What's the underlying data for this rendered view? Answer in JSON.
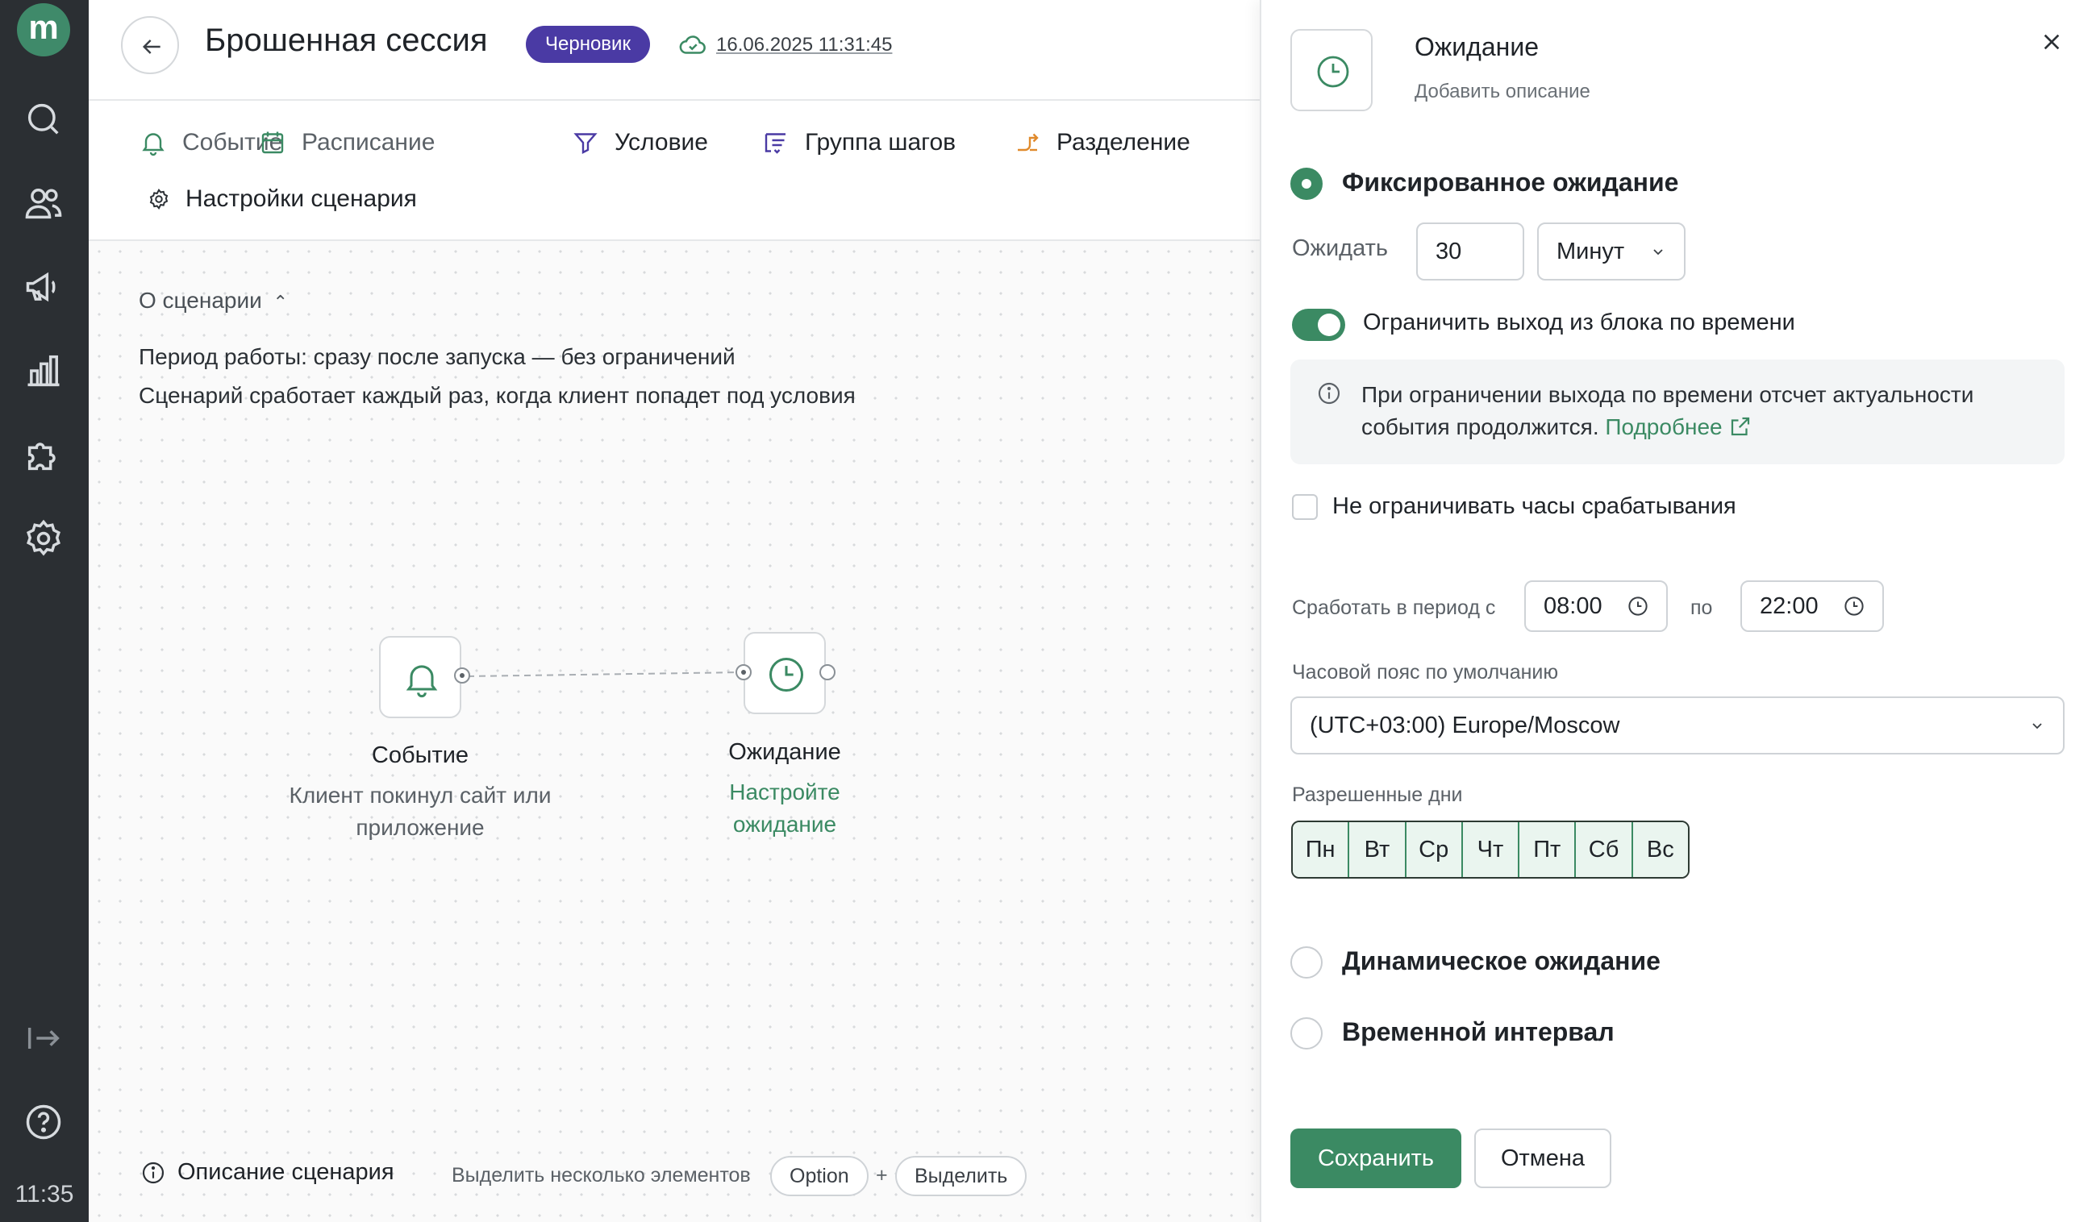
{
  "sidebar": {
    "logo_letter": "m",
    "icons": [
      "search-icon",
      "users-icon",
      "megaphone-icon",
      "analytics-icon",
      "puzzle-icon",
      "settings-icon",
      "logout-icon",
      "help-icon"
    ],
    "time": "11:35"
  },
  "header": {
    "title": "Брошенная сессия",
    "badge": "Черновик",
    "saved_at": "16.06.2025 11:31:45"
  },
  "toolbar": {
    "items": [
      {
        "label": "Событие",
        "icon": "bell-icon"
      },
      {
        "label": "Расписание",
        "icon": "calendar-icon"
      },
      {
        "label": "Условие",
        "icon": "filter-icon"
      },
      {
        "label": "Группа шагов",
        "icon": "step-group-icon"
      },
      {
        "label": "Разделение",
        "icon": "split-icon"
      },
      {
        "label": "Настройки сценария",
        "icon": "gear-icon"
      }
    ]
  },
  "about": {
    "title": "О сценарии",
    "lines": [
      "Период работы: сразу после запуска — без ограничений",
      "Сценарий сработает каждый раз, когда клиент попадет под условия"
    ]
  },
  "nodes": [
    {
      "title": "Событие",
      "subtitle_lines": [
        "Клиент покинул сайт или",
        "приложение"
      ]
    },
    {
      "title": "Ожидание",
      "subtitle_lines": [
        "Настройте",
        "ожидание"
      ]
    }
  ],
  "footer": {
    "description": "Описание сценария",
    "hint": "Выделить несколько элементов",
    "key1": "Option",
    "plus": "+",
    "key2": "Выделить"
  },
  "panel": {
    "title": "Ожидание",
    "description_placeholder": "Добавить описание",
    "options": {
      "fixed": "Фиксированное ожидание",
      "dynamic": "Динамическое ожидание",
      "interval": "Временной интервал"
    },
    "wait_label": "Ожидать",
    "wait_value": "30",
    "wait_unit": "Минут",
    "limit_toggle_label": "Ограничить выход из блока по времени",
    "info_line1": "При ограничении выхода по времени отсчет актуальности",
    "info_line2": "события продолжится.",
    "info_link": "Подробнее",
    "no_limit_hours_label": "Не ограничивать часы срабатывания",
    "period_label": "Сработать в период с",
    "period_from": "08:00",
    "period_to_label": "по",
    "period_to": "22:00",
    "timezone_label": "Часовой пояс по умолчанию",
    "timezone_value": "(UTC+03:00) Europe/Moscow",
    "days_label": "Разрешенные дни",
    "days": [
      "Пн",
      "Вт",
      "Ср",
      "Чт",
      "Пт",
      "Сб",
      "Вс"
    ],
    "save_label": "Сохранить",
    "cancel_label": "Отмена"
  },
  "colors": {
    "accent": "#3b8a63",
    "badge": "#4a3aa4",
    "sidebar": "#2b2f33"
  }
}
